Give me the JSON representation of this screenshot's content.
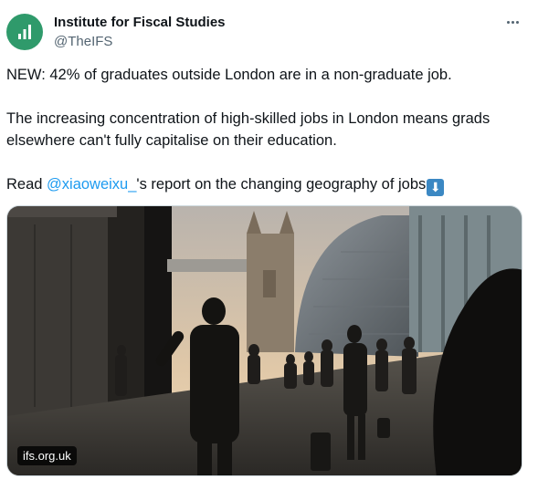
{
  "account": {
    "name": "Institute for Fiscal Studies",
    "handle": "@TheIFS",
    "avatar_icon": "ifs-bar-chart-logo",
    "avatar_color": "#2f9a6b"
  },
  "tweet": {
    "line1": "NEW: 42% of graduates outside London are in a non-graduate job.",
    "line2a": "The increasing concentration of high-skilled jobs in London means grads",
    "line2b": "elsewhere can't fully capitalise on their education.",
    "line3_prefix": "Read ",
    "line3_mention": "@xiaoweixu_",
    "line3_suffix": "'s report on the changing geography of jobs",
    "line3_emoji": "⬇",
    "line3_emoji_name": "down-arrow-emoji"
  },
  "media": {
    "domain": "ifs.org.uk"
  },
  "colors": {
    "text": "#0f1419",
    "secondary": "#536471",
    "link": "#1d9bf0"
  }
}
